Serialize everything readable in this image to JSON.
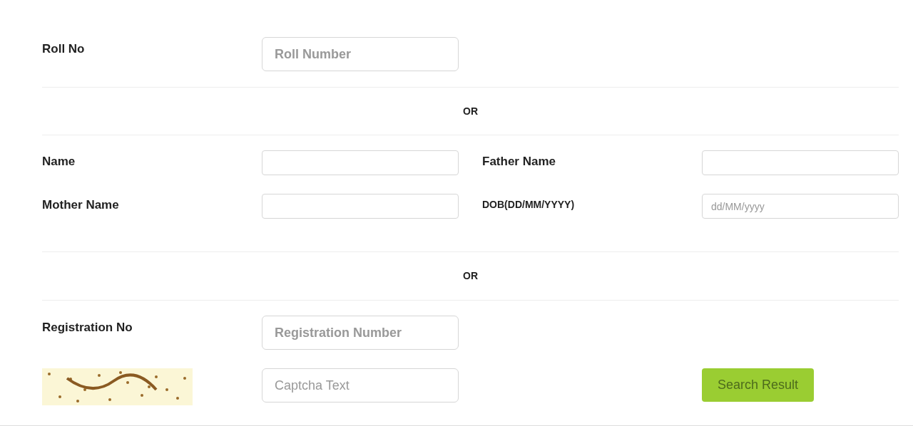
{
  "roll": {
    "label": "Roll No",
    "placeholder": "Roll Number"
  },
  "separators": [
    "OR",
    "OR"
  ],
  "details": [
    {
      "label": "Name"
    },
    {
      "label": "Father Name"
    },
    {
      "label": "Mother Name"
    },
    {
      "label": "DOB(DD/MM/YYYY)",
      "placeholder": "dd/MM/yyyy"
    }
  ],
  "registration": {
    "label": "Registration No",
    "placeholder": "Registration Number"
  },
  "captcha": {
    "placeholder": "Captcha Text"
  },
  "submit": "Search Result"
}
